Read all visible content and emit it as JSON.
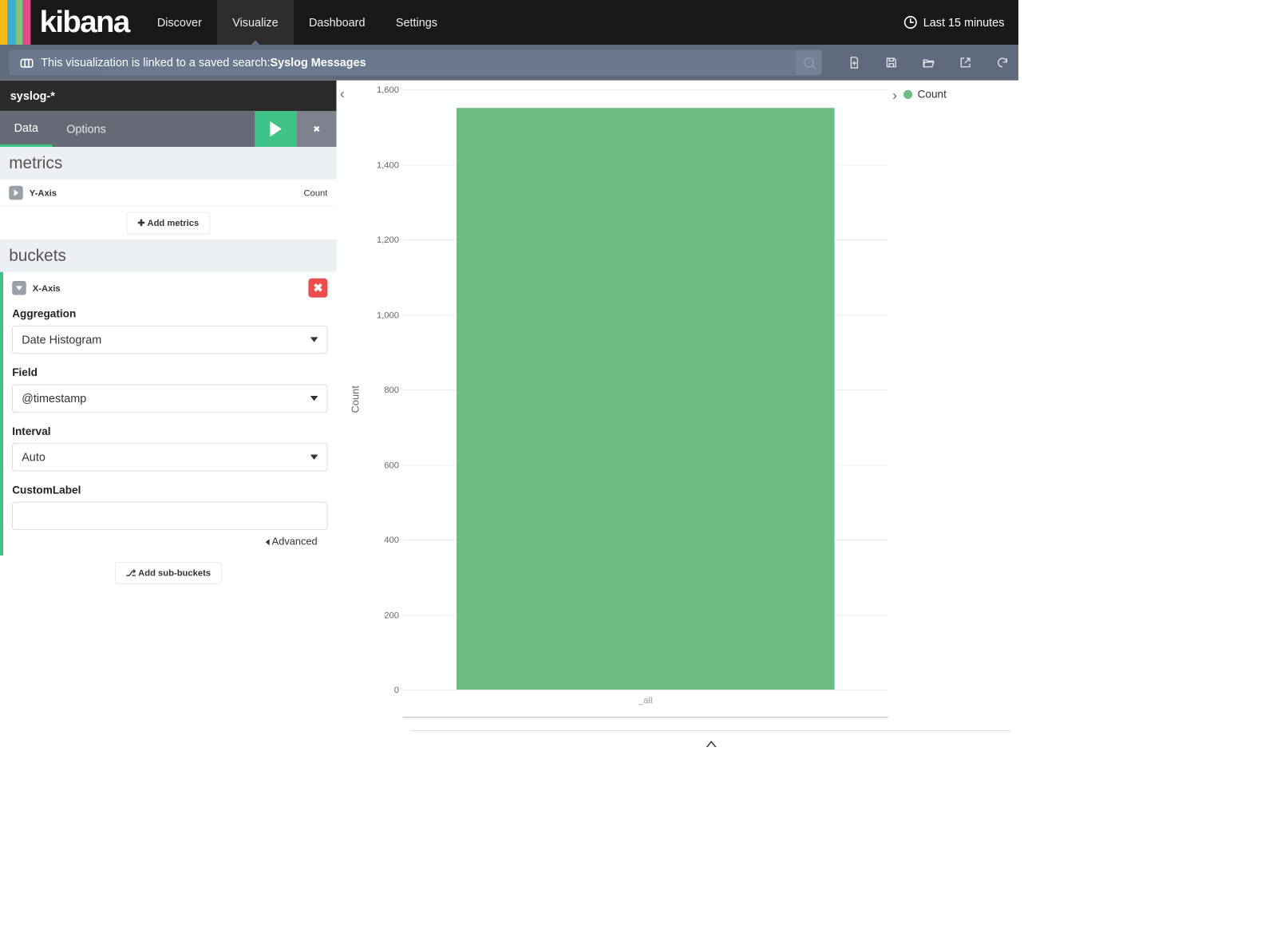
{
  "brand": "kibana",
  "nav": {
    "items": [
      "Discover",
      "Visualize",
      "Dashboard",
      "Settings"
    ],
    "active": "Visualize",
    "timepicker": "Last 15 minutes"
  },
  "linkbar": {
    "prefix": "This visualization is linked to a saved search: ",
    "name": "Syslog Messages"
  },
  "toolbar_icons": [
    "new",
    "save",
    "open",
    "share",
    "refresh"
  ],
  "index_pattern": "syslog-*",
  "tabs": {
    "data": "Data",
    "options": "Options"
  },
  "metrics": {
    "heading": "metrics",
    "yaxis_label": "Y-Axis",
    "yaxis_value": "Count",
    "add_label": "Add metrics"
  },
  "buckets": {
    "heading": "buckets",
    "xaxis_label": "X-Axis",
    "agg_label": "Aggregation",
    "agg_value": "Date Histogram",
    "field_label": "Field",
    "field_value": "@timestamp",
    "interval_label": "Interval",
    "interval_value": "Auto",
    "custom_label": "CustomLabel",
    "advanced": "Advanced",
    "add_sub": "Add sub-buckets"
  },
  "chart_data": {
    "type": "bar",
    "categories": [
      "_all"
    ],
    "values": [
      1550
    ],
    "ylabel": "Count",
    "xlabel": "",
    "ylim": [
      0,
      1600
    ],
    "yticks": [
      0,
      200,
      400,
      600,
      800,
      1000,
      1200,
      1400,
      1600
    ],
    "series": [
      {
        "name": "Count",
        "color": "#6ebd84"
      }
    ]
  },
  "legend": {
    "items": [
      "Count"
    ]
  }
}
